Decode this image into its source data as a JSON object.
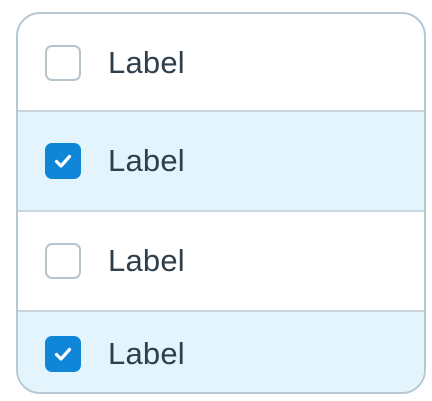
{
  "checkbox_list": {
    "items": [
      {
        "label": "Label",
        "checked": false
      },
      {
        "label": "Label",
        "checked": true
      },
      {
        "label": "Label",
        "checked": false
      },
      {
        "label": "Label",
        "checked": true
      }
    ]
  },
  "colors": {
    "accent": "#0f86d8",
    "checked_row_bg": "#e3f4fc",
    "border": "#b8c8d2",
    "text": "#2f3f4c"
  }
}
